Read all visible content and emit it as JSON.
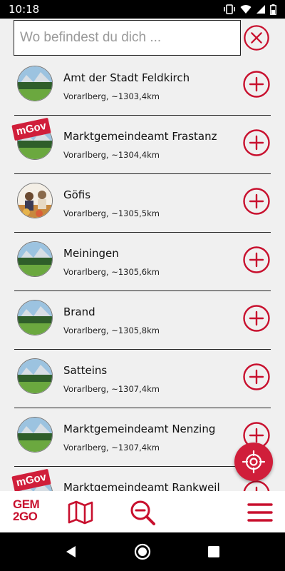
{
  "status_bar": {
    "time": "10:18"
  },
  "search": {
    "placeholder": "Wo befindest du dich ..."
  },
  "items": [
    {
      "name": "Amt der Stadt Feldkirch",
      "subtitle": "Vorarlberg, ~1303,4km",
      "badge": ""
    },
    {
      "name": "Marktgemeindeamt Frastanz",
      "subtitle": "Vorarlberg, ~1304,4km",
      "badge": "mGov"
    },
    {
      "name": "Göfis",
      "subtitle": "Vorarlberg, ~1305,5km",
      "badge": ""
    },
    {
      "name": "Meiningen",
      "subtitle": "Vorarlberg, ~1305,6km",
      "badge": ""
    },
    {
      "name": "Brand",
      "subtitle": "Vorarlberg, ~1305,8km",
      "badge": ""
    },
    {
      "name": "Satteins",
      "subtitle": "Vorarlberg, ~1307,4km",
      "badge": ""
    },
    {
      "name": "Marktgemeindeamt Nenzing",
      "subtitle": "Vorarlberg, ~1307,4km",
      "badge": ""
    },
    {
      "name": "Marktgemeindeamt Rankweil",
      "subtitle": "",
      "badge": "mGov"
    }
  ],
  "bottom_nav": {
    "logo_line1": "GEM",
    "logo_line2": "2GO"
  },
  "icons": {
    "clear": "close-circle-icon",
    "add": "plus-circle-icon",
    "locate": "crosshair-icon",
    "map": "map-icon",
    "zoom_out": "zoom-out-icon",
    "menu": "hamburger-menu-icon"
  },
  "colors": {
    "accent": "#c8102e",
    "background": "#f0f0f0"
  }
}
